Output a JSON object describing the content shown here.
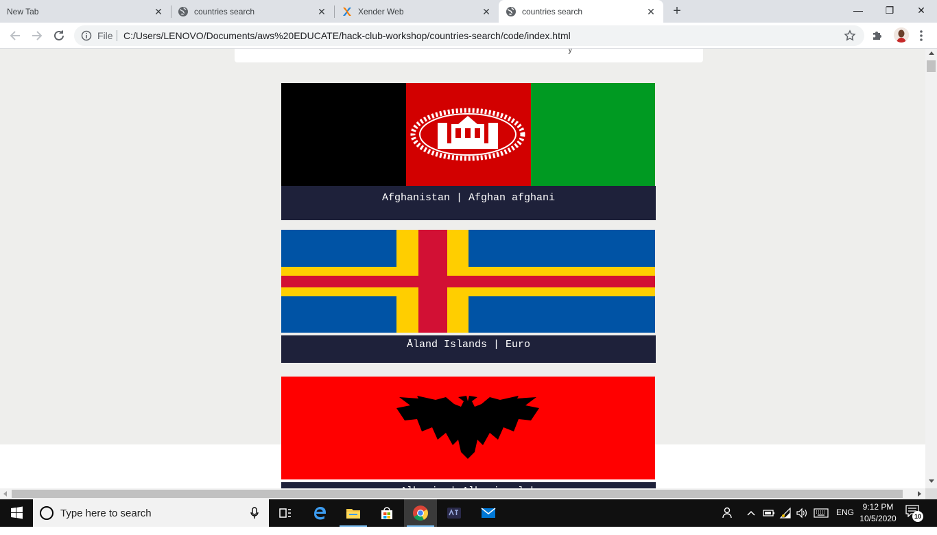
{
  "browser": {
    "tabs": [
      {
        "title": "New Tab",
        "favicon": "none",
        "active": false
      },
      {
        "title": "countries search",
        "favicon": "globe-icon",
        "active": false
      },
      {
        "title": "Xender Web",
        "favicon": "xender-icon",
        "active": false
      },
      {
        "title": "countries search",
        "favicon": "globe-icon",
        "active": true
      }
    ],
    "close_glyph": "✕",
    "new_tab_glyph": "+",
    "window_controls": {
      "minimize": "—",
      "maximize": "❐",
      "close": "✕"
    },
    "omnibox": {
      "scheme_label": "File",
      "url": "C:/Users/LENOVO/Documents/aws%20EDUCATE/hack-club-workshop/countries-search/code/index.html"
    }
  },
  "page": {
    "search_peek": "y",
    "countries": [
      {
        "caption": "Afghanistan | Afghan afghani",
        "flag": "afghanistan-flag",
        "colors": [
          "#000000",
          "#d20000",
          "#009a22"
        ]
      },
      {
        "caption": "Åland Islands | Euro",
        "flag": "aland-flag",
        "colors": [
          "#0053a5",
          "#ffce00",
          "#d21034"
        ]
      },
      {
        "caption": "Albania | Albanian lek",
        "flag": "albania-flag",
        "colors": [
          "#ff0000",
          "#000000"
        ]
      }
    ],
    "caption_bg": "#1e213a",
    "background": "#eeeeec"
  },
  "taskbar": {
    "search_placeholder": "Type here to search",
    "language": "ENG",
    "time": "9:12 PM",
    "date": "10/5/2020",
    "notification_count": "10"
  }
}
